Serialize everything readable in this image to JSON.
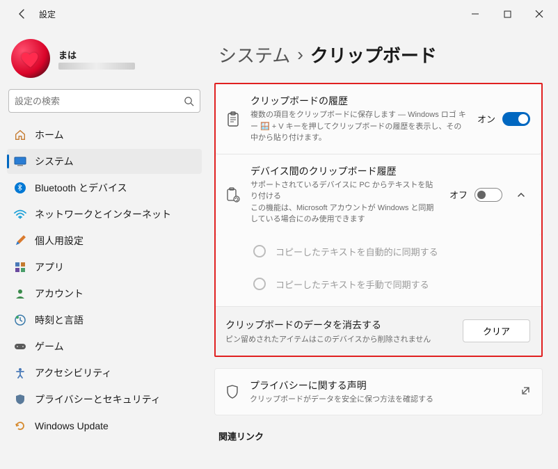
{
  "window": {
    "title": "設定"
  },
  "profile": {
    "name": "まは"
  },
  "search": {
    "placeholder": "設定の検索"
  },
  "sidebar": {
    "items": [
      {
        "label": "ホーム"
      },
      {
        "label": "システム"
      },
      {
        "label": "Bluetooth とデバイス"
      },
      {
        "label": "ネットワークとインターネット"
      },
      {
        "label": "個人用設定"
      },
      {
        "label": "アプリ"
      },
      {
        "label": "アカウント"
      },
      {
        "label": "時刻と言語"
      },
      {
        "label": "ゲーム"
      },
      {
        "label": "アクセシビリティ"
      },
      {
        "label": "プライバシーとセキュリティ"
      },
      {
        "label": "Windows Update"
      }
    ]
  },
  "breadcrumb": {
    "parent": "システム",
    "sep": "›",
    "current": "クリップボード"
  },
  "cards": {
    "history": {
      "title": "クリップボードの履歴",
      "desc": "複数の項目をクリップボードに保存します — Windows ロゴ キー 🪟 + V キーを押してクリップボードの履歴を表示し、その中から貼り付けます。",
      "state_label": "オン"
    },
    "sync": {
      "title": "デバイス間のクリップボード履歴",
      "desc": "サポートされているデバイスに PC からテキストを貼り付ける\nこの機能は、Microsoft アカウントが Windows と同期している場合にのみ使用できます",
      "state_label": "オフ",
      "options": [
        "コピーしたテキストを自動的に同期する",
        "コピーしたテキストを手動で同期する"
      ]
    },
    "clear": {
      "title": "クリップボードのデータを消去する",
      "desc": "ピン留めされたアイテムはこのデバイスから削除されません",
      "button": "クリア"
    },
    "privacy": {
      "title": "プライバシーに関する声明",
      "desc": "クリップボードがデータを安全に保つ方法を確認する"
    }
  },
  "related": {
    "heading": "関連リンク"
  }
}
